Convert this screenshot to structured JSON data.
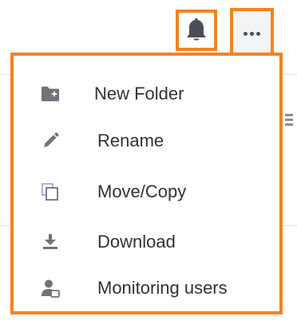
{
  "toolbar": {
    "bell_icon": "bell-icon",
    "more_icon": "more-horizontal-icon"
  },
  "menu": {
    "items": [
      {
        "label": "New Folder",
        "icon": "folder-plus-icon"
      },
      {
        "label": "Rename",
        "icon": "pencil-icon"
      },
      {
        "label": "Move/Copy",
        "icon": "copy-icon"
      },
      {
        "label": "Download",
        "icon": "download-icon"
      },
      {
        "label": "Monitoring users",
        "icon": "user-monitor-icon"
      }
    ]
  },
  "colors": {
    "highlight": "#f5821f",
    "icon_gray": "#6f737a",
    "copy_icon": "#b58ed6",
    "text": "#2f3237"
  }
}
